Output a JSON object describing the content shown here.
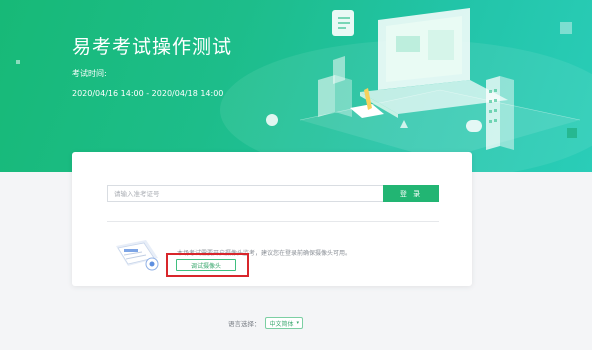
{
  "banner": {
    "title": "易考考试操作测试",
    "time_label": "考试时间:",
    "time_range": "2020/04/16 14:00 - 2020/04/18 14:00"
  },
  "login": {
    "input_placeholder": "请输入准考证号",
    "login_button": "登 录"
  },
  "camera": {
    "notice": "本场考试需要开启摄像头监考，建议您在登录前确保摄像头可用。",
    "test_button": "调试摄像头"
  },
  "language": {
    "label": "语言选择：",
    "selected": "中文简体"
  },
  "colors": {
    "banner_start": "#17b977",
    "banner_end": "#2acdb8",
    "primary_button": "#22b573",
    "highlight_box": "#d8262b"
  }
}
